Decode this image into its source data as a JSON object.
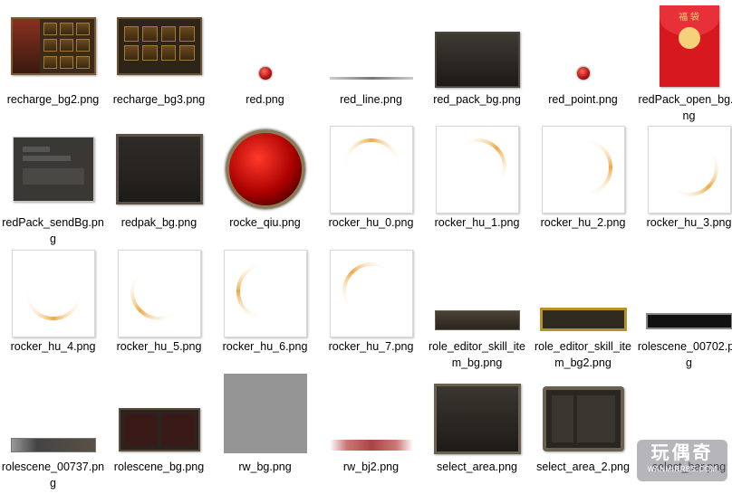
{
  "files": [
    {
      "name": "recharge_bg2.png",
      "icon": "recharge-panel-thumbnail"
    },
    {
      "name": "recharge_bg3.png",
      "icon": "recharge-panel-thumbnail"
    },
    {
      "name": "red.png",
      "icon": "red-dot-thumbnail"
    },
    {
      "name": "red_line.png",
      "icon": "red-line-thumbnail"
    },
    {
      "name": "red_pack_bg.png",
      "icon": "dark-panel-thumbnail"
    },
    {
      "name": "red_point.png",
      "icon": "red-dot-thumbnail"
    },
    {
      "name": "redPack_open_bg.png",
      "icon": "red-envelope-thumbnail"
    },
    {
      "name": "redPack_sendBg.png",
      "icon": "dark-panel-thumbnail"
    },
    {
      "name": "redpak_bg.png",
      "icon": "dark-panel-thumbnail"
    },
    {
      "name": "rocke_qiu.png",
      "icon": "red-orb-thumbnail"
    },
    {
      "name": "rocker_hu_0.png",
      "icon": "arc-thumbnail"
    },
    {
      "name": "rocker_hu_1.png",
      "icon": "arc-thumbnail"
    },
    {
      "name": "rocker_hu_2.png",
      "icon": "arc-thumbnail"
    },
    {
      "name": "rocker_hu_3.png",
      "icon": "arc-thumbnail"
    },
    {
      "name": "rocker_hu_4.png",
      "icon": "arc-thumbnail"
    },
    {
      "name": "rocker_hu_5.png",
      "icon": "arc-thumbnail"
    },
    {
      "name": "rocker_hu_6.png",
      "icon": "arc-thumbnail"
    },
    {
      "name": "rocker_hu_7.png",
      "icon": "arc-thumbnail"
    },
    {
      "name": "role_editor_skill_item_bg.png",
      "icon": "bar-thumbnail"
    },
    {
      "name": "role_editor_skill_item_bg2.png",
      "icon": "bar-thumbnail"
    },
    {
      "name": "rolescene_00702.png",
      "icon": "bar-thumbnail"
    },
    {
      "name": "rolescene_00737.png",
      "icon": "bar-thumbnail"
    },
    {
      "name": "rolescene_bg.png",
      "icon": "scene-thumbnail"
    },
    {
      "name": "rw_bg.png",
      "icon": "gray-square-thumbnail"
    },
    {
      "name": "rw_bj2.png",
      "icon": "gradient-line-thumbnail"
    },
    {
      "name": "select_area.png",
      "icon": "dark-panel-thumbnail"
    },
    {
      "name": "select_area_2.png",
      "icon": "ornate-panel-thumbnail"
    },
    {
      "name": "select_bar.png",
      "icon": "none"
    }
  ],
  "envelope_text": "福 袋",
  "watermark": {
    "title": "玩偶奇",
    "url": "WANMIRRBS.COM"
  },
  "colors": {
    "arc": "#f0b860",
    "red": "#c8161d",
    "dark": "#2e2a24"
  }
}
